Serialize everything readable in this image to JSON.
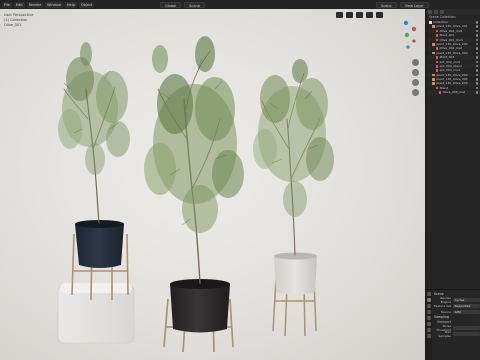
{
  "topbar": {
    "menus": [
      "File",
      "Edit",
      "Render",
      "Window",
      "Help"
    ],
    "mode": "Object",
    "center_controls": [
      "Global",
      "Scene"
    ],
    "right_controls": [
      "Scene",
      "View Layer"
    ]
  },
  "viewport": {
    "info_lines": [
      "User Perspective",
      "(1) Collection",
      "Olive_001"
    ]
  },
  "outliner": {
    "title": "Scene Collection",
    "rows": [
      {
        "label": "Collection",
        "indent": 2,
        "color": "#e8e8e8"
      },
      {
        "label": "plant_130_Olive_001",
        "indent": 4,
        "color": "#e58c3b"
      },
      {
        "label": "Olive_001_mat",
        "indent": 6,
        "color": "#d8584c"
      },
      {
        "label": "Plant_001",
        "indent": 6,
        "color": "#d8584c"
      },
      {
        "label": "Olive_001_mod",
        "indent": 6,
        "color": "#d8584c"
      },
      {
        "label": "plant_130_Olive_002",
        "indent": 4,
        "color": "#e58c3b"
      },
      {
        "label": "Olive_002_mat",
        "indent": 6,
        "color": "#d8584c"
      },
      {
        "label": "plant_130_Olive_003",
        "indent": 4,
        "color": "#e58c3b"
      },
      {
        "label": "Plant_003",
        "indent": 6,
        "color": "#d8584c"
      },
      {
        "label": "pot_002_mod",
        "indent": 6,
        "color": "#d8584c"
      },
      {
        "label": "pot_002_stand",
        "indent": 6,
        "color": "#d8584c"
      },
      {
        "label": "pot_003_mod",
        "indent": 6,
        "color": "#d8584c"
      },
      {
        "label": "plant_130_Olive_004",
        "indent": 4,
        "color": "#e58c3b"
      },
      {
        "label": "plant_130_Olive_005",
        "indent": 4,
        "color": "#e58c3b"
      },
      {
        "label": "plant_130_Olive_006",
        "indent": 4,
        "color": "#e58c3b"
      },
      {
        "label": "Stand",
        "indent": 6,
        "color": "#d8584c"
      },
      {
        "label": "Olive_006_mat",
        "indent": 8,
        "color": "#d8584c"
      }
    ]
  },
  "properties": {
    "section_title": "Scene",
    "fields": [
      {
        "label": "Render Engine",
        "value": "Cycles"
      },
      {
        "label": "Feature Set",
        "value": "Supported"
      },
      {
        "label": "Device",
        "value": "GPU"
      }
    ],
    "sampling_title": "Sampling",
    "sampling_sub": "Viewport",
    "sampling_fields": [
      {
        "label": "Noise Threshold",
        "value": ""
      },
      {
        "label": "Max Samples",
        "value": ""
      }
    ]
  },
  "colors": {
    "viewport_bg": "#e6e4e0",
    "panel_bg": "#252525",
    "accent_orange": "#e58c3b",
    "pot_blue": "#2b3242",
    "pot_dark": "#2f2c2e",
    "pot_light": "#dcdad6",
    "stand_wood": "#b09068"
  }
}
